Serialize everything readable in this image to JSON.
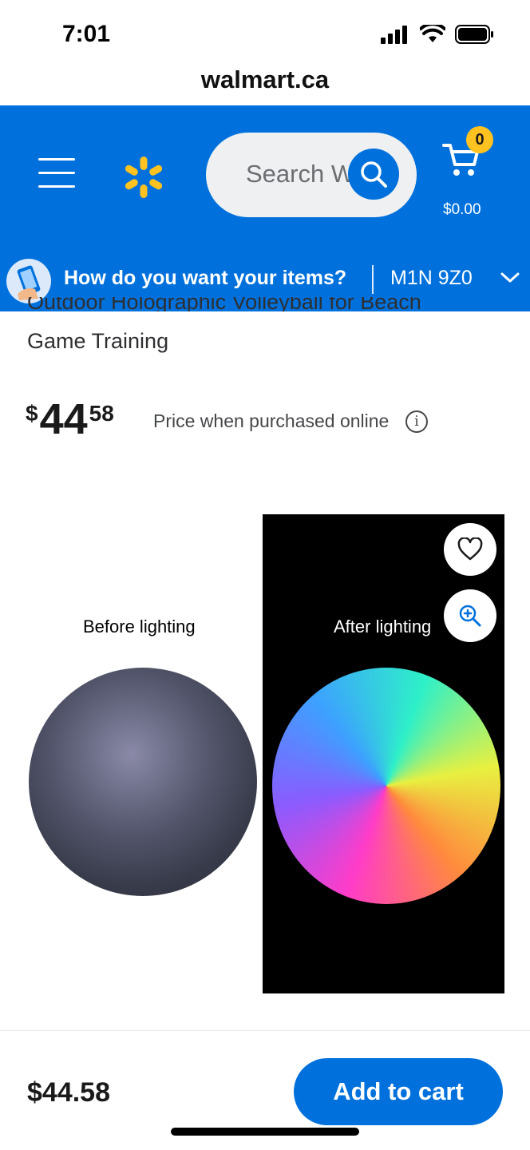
{
  "status_bar": {
    "time": "7:01"
  },
  "browser": {
    "url": "walmart.ca"
  },
  "header": {
    "search_placeholder": "Search W",
    "cart_count": "0",
    "cart_total": "$0.00"
  },
  "fulfillment": {
    "prompt": "How do you want your items?",
    "postal_code": "M1N 9Z0"
  },
  "product": {
    "title_partial": "Outdoor Holographic Volleyball for Beach",
    "title_line2": "Game Training",
    "price_currency": "$",
    "price_dollars": "44",
    "price_cents": "58",
    "price_note": "Price when purchased online",
    "image_labels": {
      "before": "Before lighting",
      "after": "After lighting"
    }
  },
  "bottom_bar": {
    "price": "$44.58",
    "add_to_cart_label": "Add to cart"
  },
  "colors": {
    "brand_blue": "#0071dc",
    "spark_yellow": "#ffc220"
  }
}
